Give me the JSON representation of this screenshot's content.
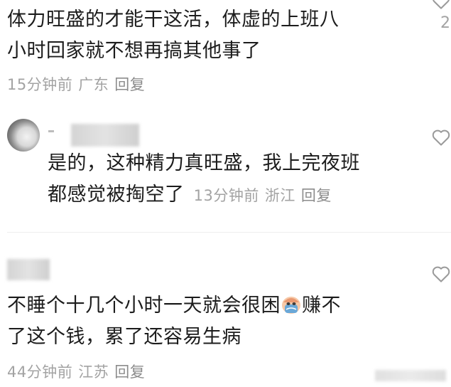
{
  "comments": [
    {
      "text_line1": "体力旺盛的才能干这活，体虚的上班八",
      "text_line2": "小时回家就不想再搞其他事了",
      "time": "15分钟前",
      "location": "广东",
      "reply": "回复",
      "like_count_partial": "2"
    },
    {
      "text_line1": "是的，这种精力真旺盛，我上完夜班",
      "text_line2": "都感觉被掏空了",
      "time": "13分钟前",
      "location": "浙江",
      "reply": "回复"
    },
    {
      "text_line1a": "不睡个十几个小时一天就会很困",
      "text_line1b": "赚不",
      "text_line2": "了这个钱，累了还容易生病",
      "emoji_icon": "crying-face-emoji-icon",
      "time": "44分钟前",
      "location": "江苏",
      "reply": "回复"
    }
  ],
  "icons": {
    "like": "heart-outline-icon"
  }
}
